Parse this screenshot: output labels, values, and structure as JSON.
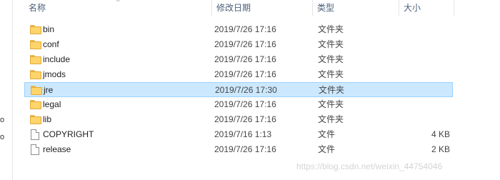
{
  "header": {
    "name_label": "名称",
    "date_label": "修改日期",
    "type_label": "类型",
    "size_label": "大小",
    "sort_indicator": "^"
  },
  "files": [
    {
      "name": "bin",
      "date": "2019/7/26 17:16",
      "type": "文件夹",
      "size": "",
      "icon": "folder-icon",
      "selected": false
    },
    {
      "name": "conf",
      "date": "2019/7/26 17:16",
      "type": "文件夹",
      "size": "",
      "icon": "folder-icon",
      "selected": false
    },
    {
      "name": "include",
      "date": "2019/7/26 17:16",
      "type": "文件夹",
      "size": "",
      "icon": "folder-icon",
      "selected": false
    },
    {
      "name": "jmods",
      "date": "2019/7/26 17:16",
      "type": "文件夹",
      "size": "",
      "icon": "folder-icon",
      "selected": false
    },
    {
      "name": "jre",
      "date": "2019/7/26 17:30",
      "type": "文件夹",
      "size": "",
      "icon": "folder-icon",
      "selected": true
    },
    {
      "name": "legal",
      "date": "2019/7/26 17:16",
      "type": "文件夹",
      "size": "",
      "icon": "folder-icon",
      "selected": false
    },
    {
      "name": "lib",
      "date": "2019/7/26 17:16",
      "type": "文件夹",
      "size": "",
      "icon": "folder-icon",
      "selected": false
    },
    {
      "name": "COPYRIGHT",
      "date": "2019/7/16 1:13",
      "type": "文件",
      "size": "4 KB",
      "icon": "file-icon",
      "selected": false
    },
    {
      "name": "release",
      "date": "2019/7/26 17:16",
      "type": "文件",
      "size": "2 KB",
      "icon": "file-icon",
      "selected": false
    }
  ],
  "left_edge_glyphs": [
    "o",
    "o"
  ],
  "watermark": "https://blog.csdn.net/weixin_44754046",
  "colors": {
    "selection_bg": "#cce8ff",
    "selection_border": "#99d1ff",
    "folder": "#ffd56b",
    "header_text": "#4c607a"
  }
}
